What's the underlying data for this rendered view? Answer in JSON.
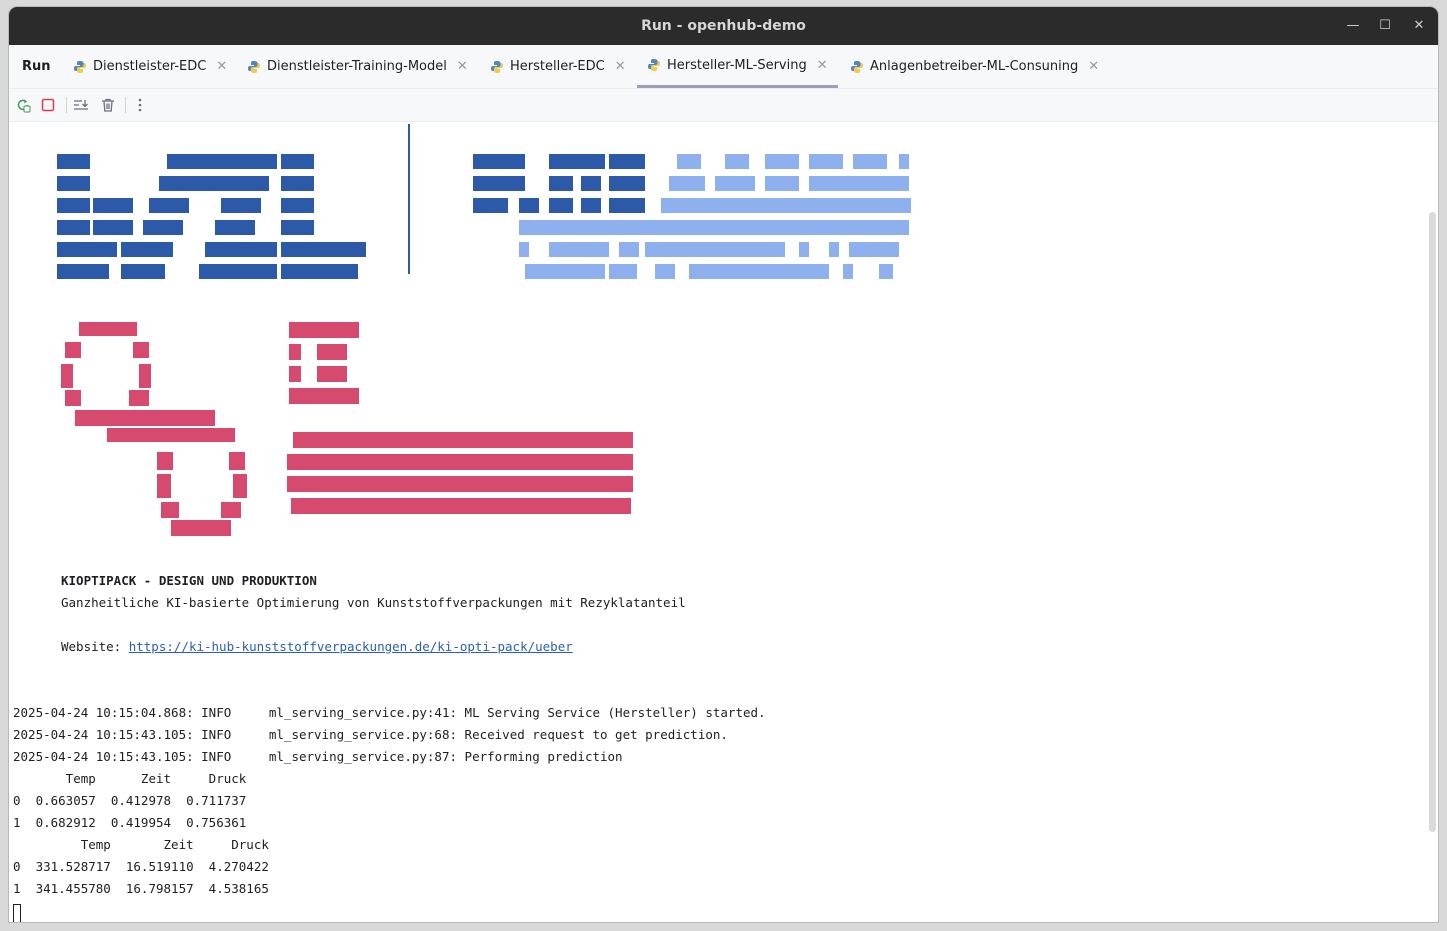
{
  "window": {
    "title": "Run - openhub-demo"
  },
  "run_label": "Run",
  "tabs": [
    {
      "label": "Dienstleister-EDC"
    },
    {
      "label": "Dienstleister-Training-Model"
    },
    {
      "label": "Hersteller-EDC"
    },
    {
      "label": "Hersteller-ML-Serving"
    },
    {
      "label": "Anlagenbetreiber-ML-Consuning"
    }
  ],
  "active_tab": "Hersteller-ML-Serving",
  "toolbar": {
    "icons": [
      "rerun-icon",
      "stop-icon",
      "scroll-to-end-icon",
      "clear-icon",
      "more-icon"
    ]
  },
  "colors": {
    "logo_dark_blue": "#2d5aa8",
    "logo_light_blue": "#8fb0ee",
    "logo_pink": "#d64a6f",
    "link": "#2a5fb2"
  },
  "banner": {
    "heading": "KIOPTIPACK - DESIGN UND PRODUKTION",
    "subtitle": "Ganzheitliche KI-basierte Optimierung von Kunststoffverpackungen mit Rezyklatanteil",
    "website_label": "Website: ",
    "website_url": "https://ki-hub-kunststoffverpackungen.de/ki-opti-pack/ueber"
  },
  "log_lines": [
    "2025-04-24 10:15:04.868: INFO     ml_serving_service.py:41: ML Serving Service (Hersteller) started.",
    "2025-04-24 10:15:43.105: INFO     ml_serving_service.py:68: Received request to get prediction.",
    "2025-04-24 10:15:43.105: INFO     ml_serving_service.py:87: Performing prediction",
    "       Temp      Zeit     Druck",
    "0  0.663057  0.412978  0.711737",
    "1  0.682912  0.419954  0.756361",
    "         Temp       Zeit     Druck",
    "0  331.528717  16.519110  4.270422",
    "1  341.455780  16.798157  4.538165"
  ]
}
